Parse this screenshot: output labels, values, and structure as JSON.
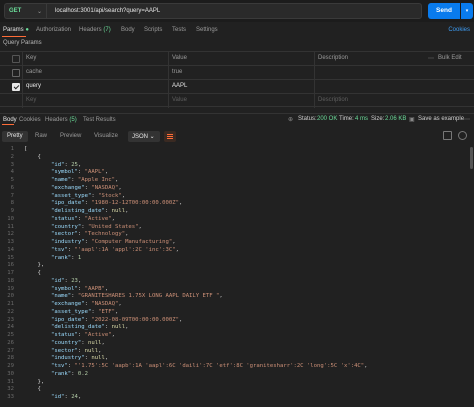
{
  "request": {
    "method": "GET",
    "url": "localhost:3001/api/search?query=AAPL",
    "send_label": "Send"
  },
  "req_tabs": {
    "params": "Params",
    "authorization": "Authorization",
    "headers": "Headers",
    "headers_count": "(7)",
    "body": "Body",
    "scripts": "Scripts",
    "tests": "Tests",
    "settings": "Settings",
    "cookies": "Cookies"
  },
  "query_params_label": "Query Params",
  "params_table": {
    "col_key": "Key",
    "col_value": "Value",
    "col_description": "Description",
    "bulk_edit": "Bulk Edit",
    "rows": [
      {
        "key": "cache",
        "value": "true",
        "checked": false
      },
      {
        "key": "query",
        "value": "AAPL",
        "checked": true
      }
    ],
    "placeholder_key": "Key",
    "placeholder_value": "Value",
    "placeholder_description": "Description"
  },
  "resp_tabs": {
    "body": "Body",
    "cookies": "Cookies",
    "headers": "Headers",
    "headers_count": "(5)",
    "test_results": "Test Results"
  },
  "resp_status": {
    "status_label": "Status:",
    "status_value": "200 OK",
    "time_label": "Time:",
    "time_value": "4 ms",
    "size_label": "Size:",
    "size_value": "2.06 KB",
    "save_label": "Save as example"
  },
  "format_tabs": {
    "pretty": "Pretty",
    "raw": "Raw",
    "preview": "Preview",
    "visualize": "Visualize",
    "format": "JSON"
  },
  "code_lines": [
    "[",
    "    {",
    "        \"id\": 25,",
    "        \"symbol\": \"AAPL\",",
    "        \"name\": \"Apple Inc\",",
    "        \"exchange\": \"NASDAQ\",",
    "        \"asset_type\": \"Stock\",",
    "        \"ipo_date\": \"1980-12-12T00:00:00.000Z\",",
    "        \"delisting_date\": null,",
    "        \"status\": \"Active\",",
    "        \"country\": \"United States\",",
    "        \"sector\": \"Technology\",",
    "        \"industry\": \"Computer Manufacturing\",",
    "        \"tsv\": \"'aapl':1A 'appl':2C 'inc':3C\",",
    "        \"rank\": 1",
    "    },",
    "    {",
    "        \"id\": 23,",
    "        \"symbol\": \"AAPB\",",
    "        \"name\": \"GRANITESHARES 1.75X LONG AAPL DAILY ETF \",",
    "        \"exchange\": \"NASDAQ\",",
    "        \"asset_type\": \"ETF\",",
    "        \"ipo_date\": \"2022-08-09T00:00:00.000Z\",",
    "        \"delisting_date\": null,",
    "        \"status\": \"Active\",",
    "        \"country\": null,",
    "        \"sector\": null,",
    "        \"industry\": null,",
    "        \"tsv\": \"'1.75':5C 'aapb':1A 'aapl':6C 'daili':7C 'etf':8C 'granitesharr':2C 'long':5C 'x':4C\",",
    "        \"rank\": 0.2",
    "    },",
    "    {",
    "        \"id\": 24,"
  ]
}
